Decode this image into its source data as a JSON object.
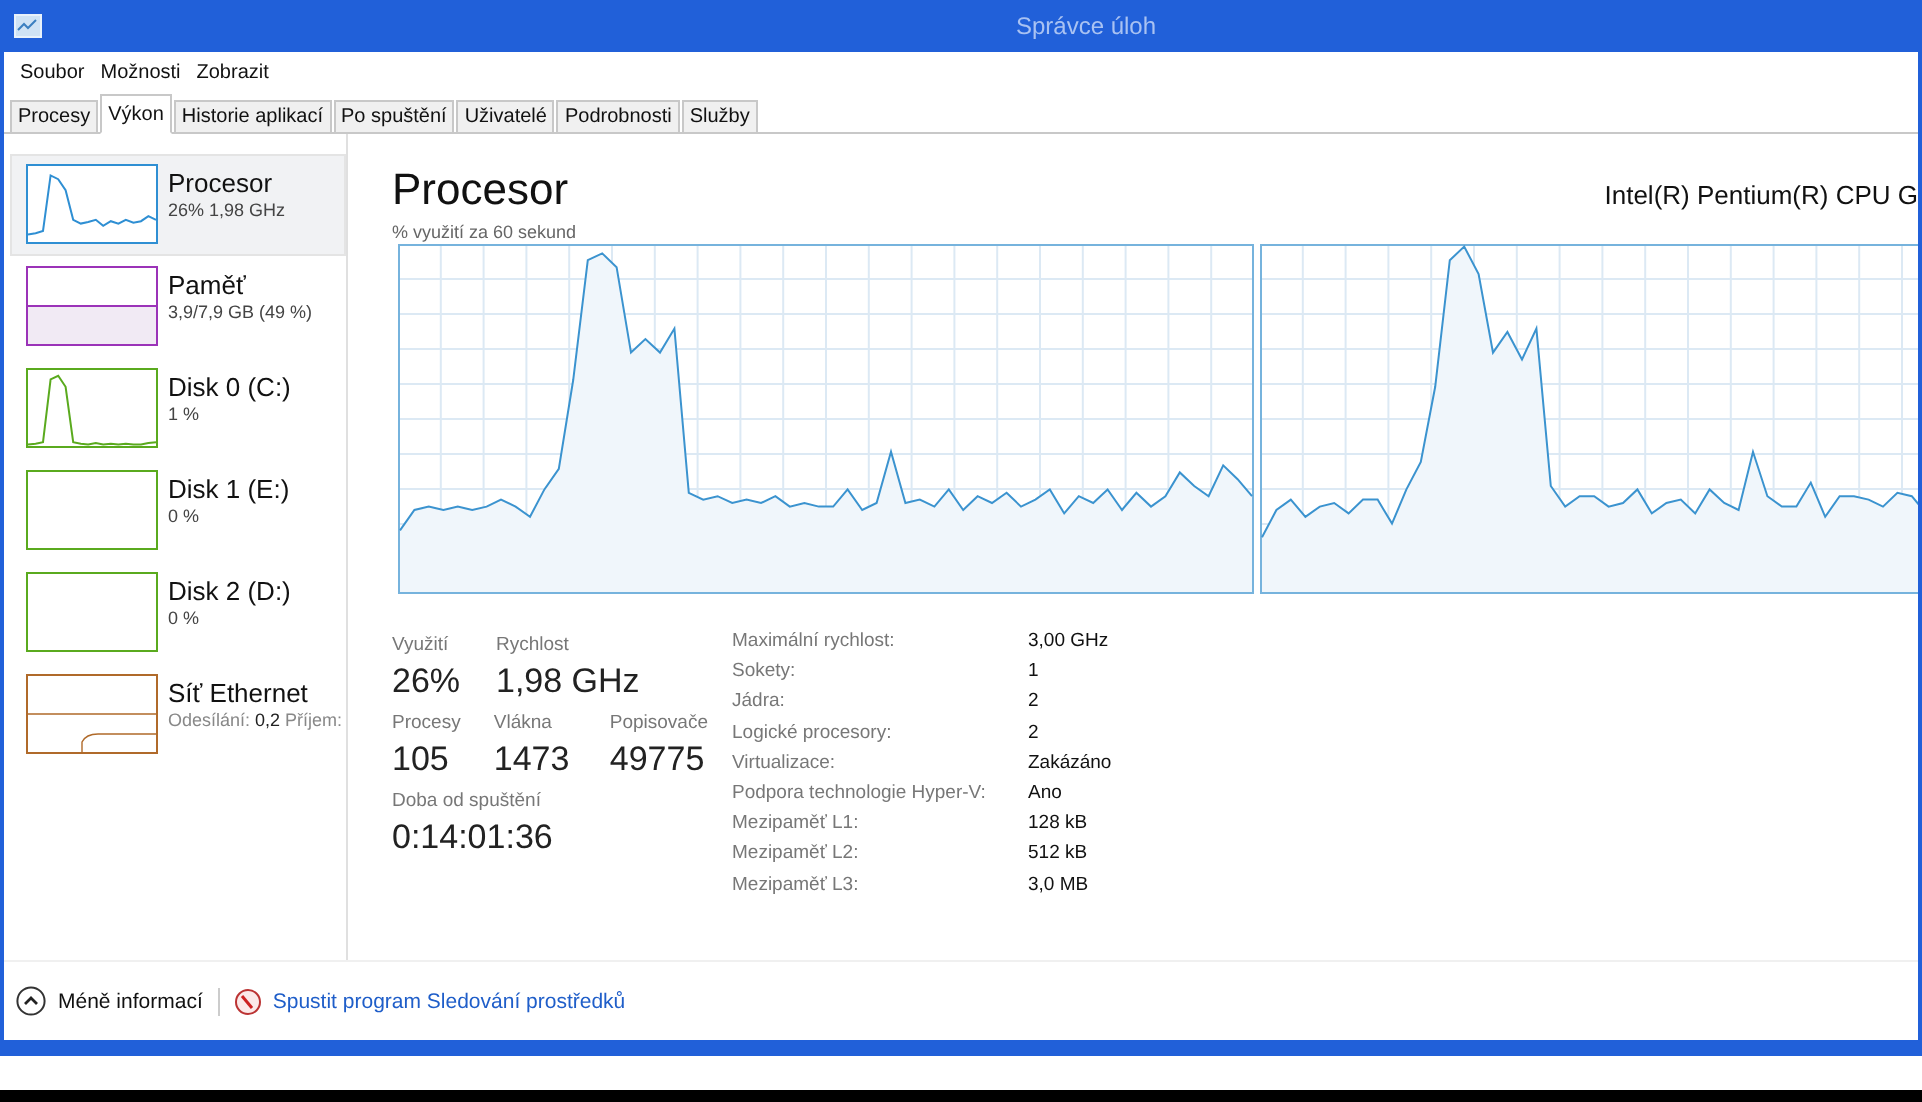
{
  "window": {
    "title": "Správce úloh"
  },
  "menu": [
    "Soubor",
    "Možnosti",
    "Zobrazit"
  ],
  "tabs": [
    {
      "label": "Procesy",
      "selected": false
    },
    {
      "label": "Výkon",
      "selected": true
    },
    {
      "label": "Historie aplikací",
      "selected": false
    },
    {
      "label": "Po spuštění",
      "selected": false
    },
    {
      "label": "Uživatelé",
      "selected": false
    },
    {
      "label": "Podrobnosti",
      "selected": false
    },
    {
      "label": "Služby",
      "selected": false
    }
  ],
  "sidebar": {
    "items": [
      {
        "name": "Procesor",
        "detail": "26% 1,98 GHz",
        "color": "#2f8fd3",
        "selected": true
      },
      {
        "name": "Paměť",
        "detail": "3,9/7,9 GB (49 %)",
        "color": "#9b33b8",
        "selected": false
      },
      {
        "name": "Disk 0 (C:)",
        "detail": "1 %",
        "color": "#5aaa1e",
        "selected": false
      },
      {
        "name": "Disk 1 (E:)",
        "detail": "0 %",
        "color": "#5aaa1e",
        "selected": false
      },
      {
        "name": "Disk 2 (D:)",
        "detail": "0 %",
        "color": "#5aaa1e",
        "selected": false
      },
      {
        "name": "Síť Ethernet",
        "detail": "Odesílání: **0,2** Příjem:",
        "color": "#b06a2a",
        "selected": false
      }
    ]
  },
  "main": {
    "title": "Procesor",
    "model": "Intel(R) Pentium(R) CPU G",
    "graph_caption": "% využití za 60 sekund",
    "stats": [
      [
        {
          "label": "Využití",
          "value": "26%"
        },
        {
          "label": "Rychlost",
          "value": "1,98 GHz"
        }
      ],
      [
        {
          "label": "Procesy",
          "value": "105"
        },
        {
          "label": "Vlákna",
          "value": "1473"
        },
        {
          "label": "Popisovače",
          "value": "49775"
        }
      ],
      [
        {
          "label": "Doba od spuštění",
          "value": "0:14:01:36"
        }
      ]
    ],
    "specs": [
      {
        "label": "Maximální rychlost:",
        "value": "3,00 GHz"
      },
      {
        "label": "Sokety:",
        "value": "1"
      },
      {
        "label": "Jádra:",
        "value": "2"
      },
      {
        "label": "Logické procesory:",
        "value": "2"
      },
      {
        "label": "Virtualizace:",
        "value": "Zakázáno"
      },
      {
        "label": "Podpora technologie Hyper-V:",
        "value": "Ano"
      },
      {
        "label": "Mezipaměť L1:",
        "value": "128 kB"
      },
      {
        "label": "Mezipaměť L2:",
        "value": "512 kB"
      },
      {
        "label": "Mezipaměť L3:",
        "value": "3,0 MB"
      }
    ]
  },
  "footer": {
    "less": "Méně informací",
    "link": "Spustit program Sledování prostředků"
  }
}
